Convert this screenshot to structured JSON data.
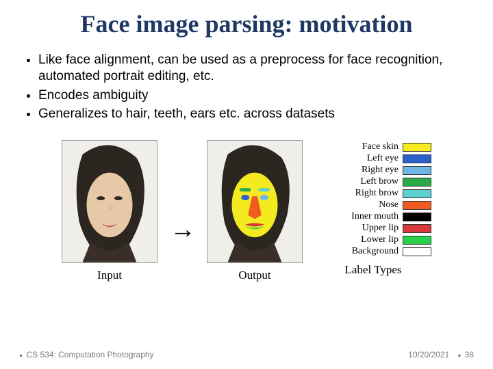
{
  "title": "Face image parsing: motivation",
  "bullets": [
    "Like face alignment, can be used as a preprocess for face recognition, automated portrait editing, etc.",
    "Encodes ambiguity",
    "Generalizes to hair, teeth, ears etc. across datasets"
  ],
  "figure": {
    "input_caption": "Input",
    "output_caption": "Output",
    "legend_caption": "Label Types",
    "arrow": "→",
    "labels": [
      {
        "name": "Face skin",
        "color": "#f7ea1e"
      },
      {
        "name": "Left eye",
        "color": "#2a5ecb"
      },
      {
        "name": "Right eye",
        "color": "#6fb5e6"
      },
      {
        "name": "Left brow",
        "color": "#2aa84a"
      },
      {
        "name": "Right brow",
        "color": "#5fd0d0"
      },
      {
        "name": "Nose",
        "color": "#f25b1f"
      },
      {
        "name": "Inner mouth",
        "color": "#000000"
      },
      {
        "name": "Upper lip",
        "color": "#d93838"
      },
      {
        "name": "Lower lip",
        "color": "#26d24a"
      },
      {
        "name": "Background",
        "color": "#ffffff"
      }
    ]
  },
  "footer": {
    "course": "CS 534: Computation Photography",
    "date": "10/20/2021",
    "page": "38"
  }
}
